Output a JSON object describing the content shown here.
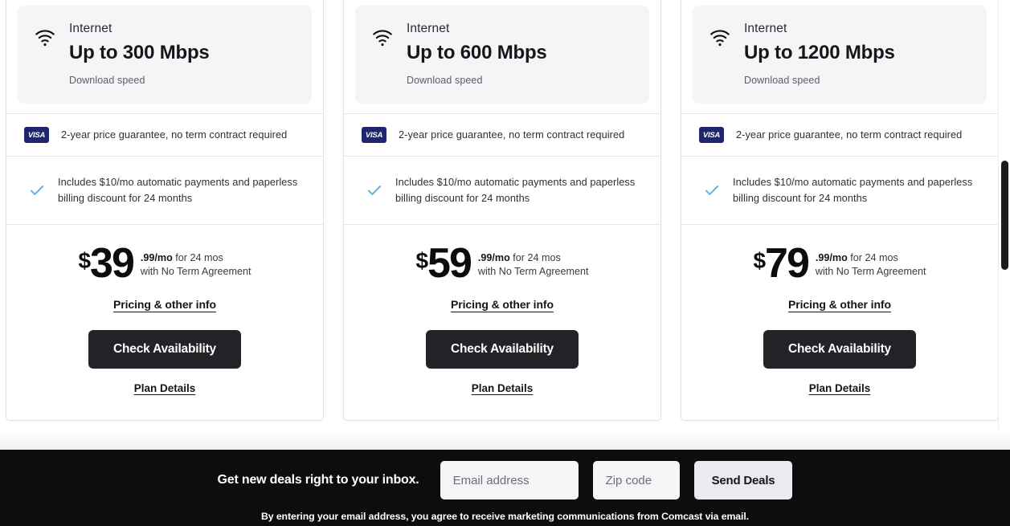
{
  "plans": [
    {
      "eyebrow": "Internet",
      "headline": "Up to 300 Mbps",
      "sub": "Download speed",
      "wifi_icon": "wifi-icon",
      "guarantee_badge": "VISA",
      "guarantee_text": "2-year price guarantee, no term contract required",
      "discount_icon": "check-icon",
      "discount_text": "Includes $10/mo automatic payments and paperless billing discount for 24 months",
      "currency": "$",
      "dollars": "39",
      "cents_line": ".99/mo",
      "term_line": " for 24 mos",
      "agreement_line": "with No Term Agreement",
      "pricing_link": "Pricing & other info",
      "cta_label": "Check Availability",
      "details_link": "Plan Details"
    },
    {
      "eyebrow": "Internet",
      "headline": "Up to 600 Mbps",
      "sub": "Download speed",
      "wifi_icon": "wifi-icon",
      "guarantee_badge": "VISA",
      "guarantee_text": "2-year price guarantee, no term contract required",
      "discount_icon": "check-icon",
      "discount_text": "Includes $10/mo automatic payments and paperless billing discount for 24 months",
      "currency": "$",
      "dollars": "59",
      "cents_line": ".99/mo",
      "term_line": " for 24 mos",
      "agreement_line": "with No Term Agreement",
      "pricing_link": "Pricing & other info",
      "cta_label": "Check Availability",
      "details_link": "Plan Details"
    },
    {
      "eyebrow": "Internet",
      "headline": "Up to 1200 Mbps",
      "sub": "Download speed",
      "wifi_icon": "wifi-icon",
      "guarantee_badge": "VISA",
      "guarantee_text": "2-year price guarantee, no term contract required",
      "discount_icon": "check-icon",
      "discount_text": "Includes $10/mo automatic payments and paperless billing discount for 24 months",
      "currency": "$",
      "dollars": "79",
      "cents_line": ".99/mo",
      "term_line": " for 24 mos",
      "agreement_line": "with No Term Agreement",
      "pricing_link": "Pricing & other info",
      "cta_label": "Check Availability",
      "details_link": "Plan Details"
    }
  ],
  "newsletter": {
    "title": "Get new deals right to your inbox.",
    "email_placeholder": "Email address",
    "email_value": "",
    "zip_placeholder": "Zip code",
    "zip_value": "",
    "send_label": "Send Deals",
    "disclaimer": "By entering your email address, you agree to receive marketing communications from Comcast via email."
  },
  "colors": {
    "card_border": "#e2e2e6",
    "speed_panel_bg": "#f5f5f7",
    "cta_bg": "#232327",
    "visa_navy": "#1f266e",
    "check_blue": "#5cb4e4",
    "bar_bg": "#0d0d0f",
    "send_bg": "#edeaef"
  }
}
